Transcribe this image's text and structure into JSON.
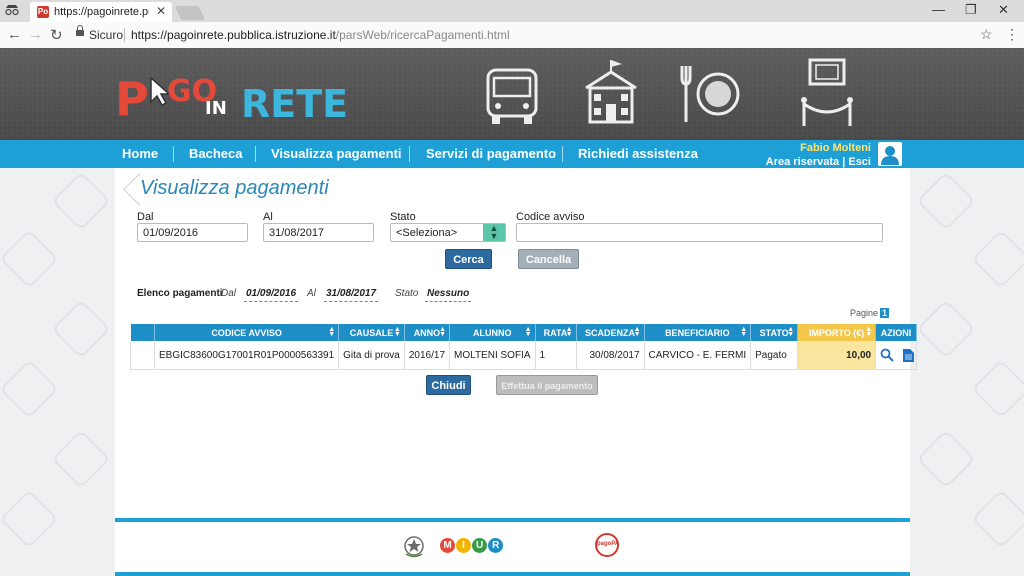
{
  "browser": {
    "tab_title": "https://pagoinrete.pubbli",
    "tab_favicon": "Po",
    "url_secure_label": "Sicuro",
    "url_host": "https://pagoinrete.pubblica.istruzione.it",
    "url_path": "/parsWeb/ricercaPagamenti.html",
    "icons": [
      "incognito-icon",
      "back-icon",
      "forward-icon",
      "reload-icon",
      "lock-icon",
      "star-icon",
      "menu-icon",
      "minimize-icon",
      "maximize-icon",
      "close-icon"
    ]
  },
  "header": {
    "logo": {
      "p": "P",
      "go": "GO",
      "in": "IN",
      "rete": "RETE"
    },
    "illustrations": [
      "bus-icon",
      "school-icon",
      "dining-icon",
      "museum-icon"
    ]
  },
  "nav": {
    "items": [
      "Home",
      "Bacheca",
      "Visualizza pagamenti",
      "Servizi di pagamento",
      "Richiedi assistenza"
    ],
    "user_name": "Fabio Molteni",
    "user_area": "Area riservata | Esci"
  },
  "page": {
    "title": "Visualizza pagamenti",
    "filters": {
      "dal_label": "Dal",
      "dal_value": "01/09/2016",
      "al_label": "Al",
      "al_value": "31/08/2017",
      "stato_label": "Stato",
      "stato_value": "<Seleziona>",
      "codice_label": "Codice avviso",
      "codice_value": ""
    },
    "buttons": {
      "cerca": "Cerca",
      "cancella": "Cancella",
      "chiudi": "Chiudi",
      "effettua": "Effettua il pagamento"
    },
    "summary": {
      "label": "Elenco pagamenti",
      "dal_label": "Dal",
      "dal_value": "01/09/2016",
      "al_label": "Al",
      "al_value": "31/08/2017",
      "stato_label": "Stato",
      "stato_value": "Nessuno"
    },
    "pager": {
      "label": "Pagine",
      "current": "1"
    }
  },
  "table": {
    "headers": [
      "CODICE AVVISO",
      "CAUSALE",
      "ANNO",
      "ALUNNO",
      "RATA",
      "SCADENZA",
      "BENEFICIARIO",
      "STATO",
      "IMPORTO (€)",
      "AZIONI"
    ],
    "rows": [
      {
        "codice": "EBGIC83600G17001R01P0000563391",
        "causale": "Gita di prova",
        "anno": "2016/17",
        "alunno": "MOLTENI SOFIA",
        "rata": "1",
        "scadenza": "30/08/2017",
        "beneficiario": "CARVICO - E. FERMI",
        "stato": "Pagato",
        "importo": "10,00",
        "azioni": [
          "search-icon",
          "document-icon"
        ]
      }
    ]
  },
  "footer": {
    "logos": [
      "repubblica-emblem-icon",
      "miur-logo",
      "pagopa-logo"
    ],
    "miur_letters": [
      "M",
      "I",
      "U",
      "R"
    ],
    "pagopa_text": "pagoPA"
  },
  "colors": {
    "accent": "#1ea0d6",
    "brand_red": "#e5493a",
    "brand_blue": "#3cb6dc",
    "importo_bg": "#fbe6a0",
    "btn_blue": "#2d6a9f"
  }
}
